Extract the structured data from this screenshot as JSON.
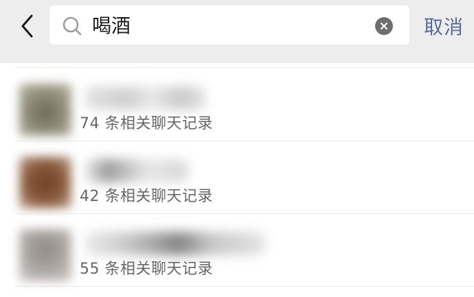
{
  "search": {
    "query": "喝酒",
    "cancel_label": "取消"
  },
  "results": [
    {
      "count_text": "74 条相关聊天记录"
    },
    {
      "count_text": "42 条相关聊天记录"
    },
    {
      "count_text": "55 条相关聊天记录"
    }
  ],
  "colors": {
    "header_bg": "#ededed",
    "accent": "#576b95",
    "secondary_text": "#666666"
  },
  "icons": {
    "back": "chevron-left-icon",
    "search": "magnifier-icon",
    "clear": "close-circle-icon"
  }
}
